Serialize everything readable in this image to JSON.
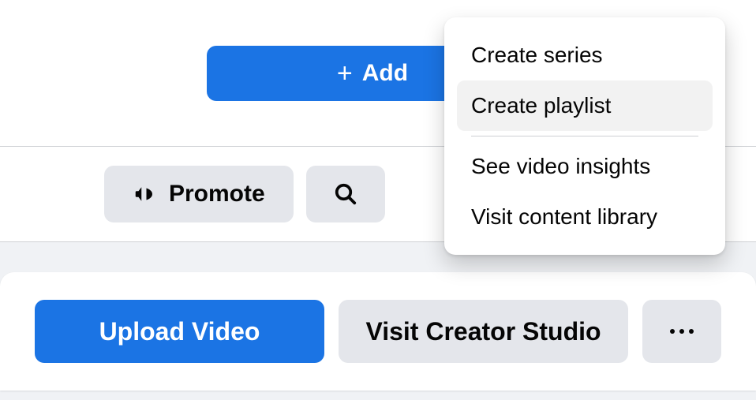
{
  "top": {
    "add_label": "Add"
  },
  "mid": {
    "promote_label": "Promote"
  },
  "card": {
    "upload_label": "Upload Video",
    "creator_label": "Visit Creator Studio"
  },
  "menu": {
    "create_series": "Create series",
    "create_playlist": "Create playlist",
    "see_insights": "See video insights",
    "visit_library": "Visit content library"
  }
}
